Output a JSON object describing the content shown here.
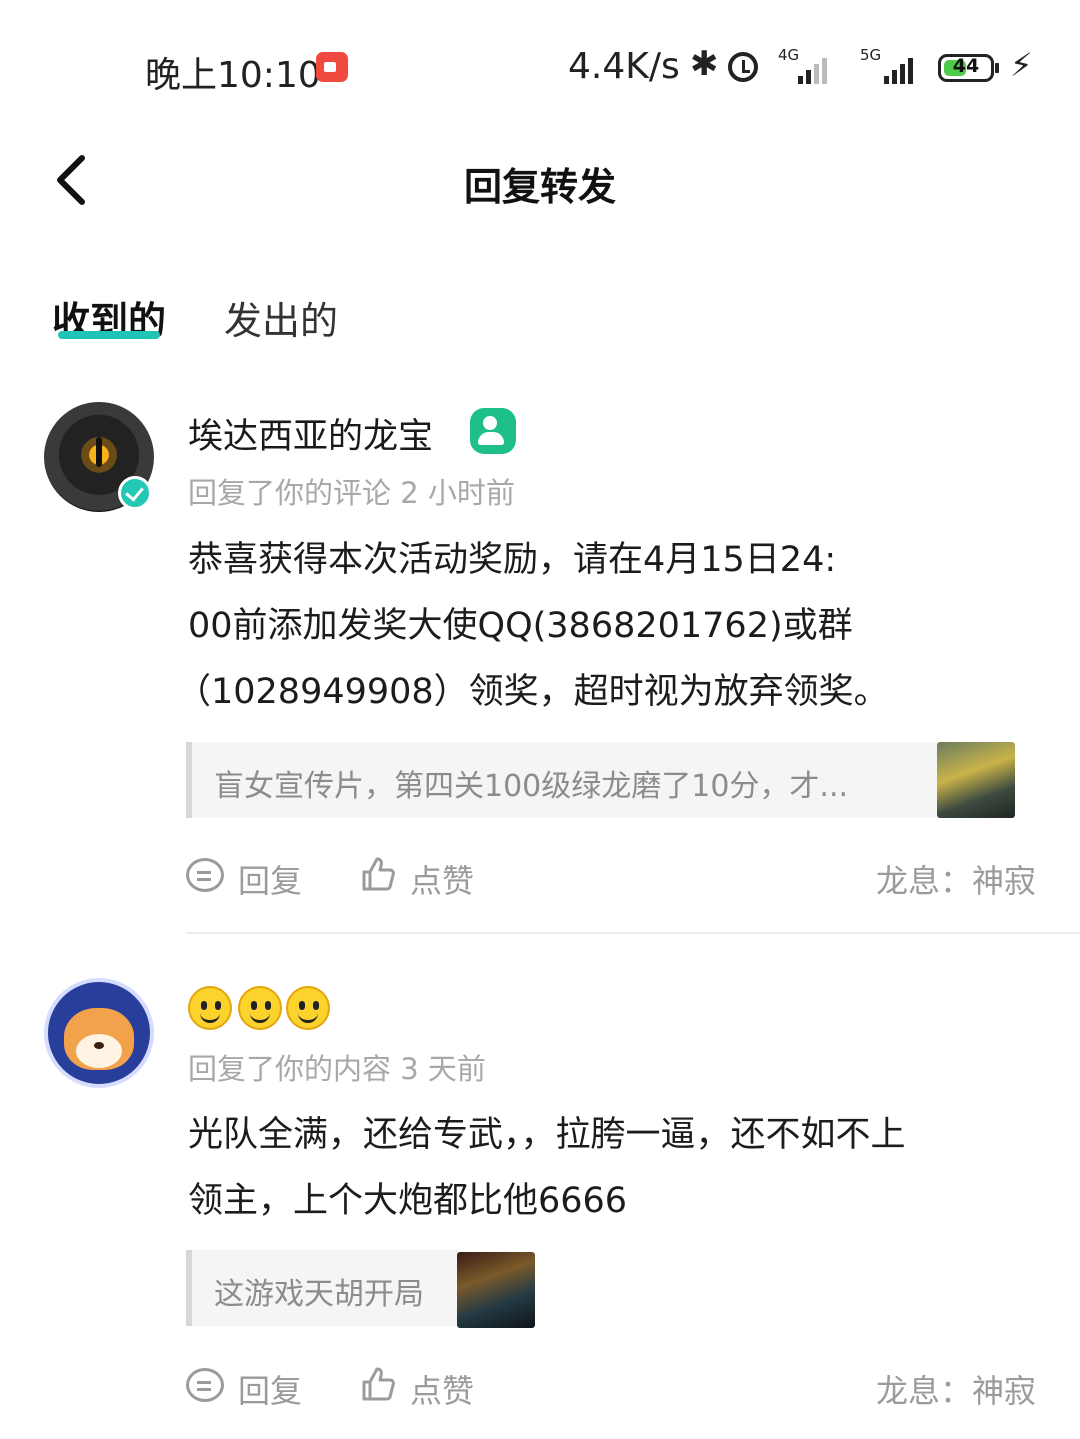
{
  "status_bar": {
    "time": "晚上10:10",
    "speed": "4.4K/s",
    "network_1": "4G",
    "network_2": "5G",
    "battery": "44"
  },
  "header": {
    "title": "回复转发"
  },
  "tabs": [
    {
      "label": "收到的",
      "active": true
    },
    {
      "label": "发出的",
      "active": false
    }
  ],
  "items": [
    {
      "username": "埃达西亚的龙宝",
      "meta": "回复了你的评论 2 小时前",
      "content_lines": [
        "恭喜获得本次活动奖励，请在4月15日24:",
        "00前添加发奖大使QQ(3868201762)或群",
        "（1028949908）领奖，超时视为放弃领奖。"
      ],
      "quote": "盲女宣传片，第四关100级绿龙磨了10分，才...",
      "reply_label": "回复",
      "like_label": "点赞",
      "source": "龙息：神寂"
    },
    {
      "username": "",
      "meta": "回复了你的内容 3 天前",
      "content_lines": [
        "光队全满，还给专武，，拉胯一逼，还不如不上",
        "领主，上个大炮都比他6666"
      ],
      "quote": "这游戏天胡开局",
      "reply_label": "回复",
      "like_label": "点赞",
      "source": "龙息：神寂"
    }
  ],
  "colors": {
    "accent": "#20c4b4",
    "level_badge": "#1fbf8b",
    "muted": "#a8a8a8"
  },
  "icons": [
    "back-arrow-icon",
    "recording-icon",
    "bluetooth-icon",
    "alarm-icon",
    "signal-icon",
    "battery-icon",
    "charging-icon",
    "verified-icon",
    "level-badge-icon",
    "smiley-emoji-icon",
    "comment-icon",
    "thumbs-up-icon"
  ]
}
